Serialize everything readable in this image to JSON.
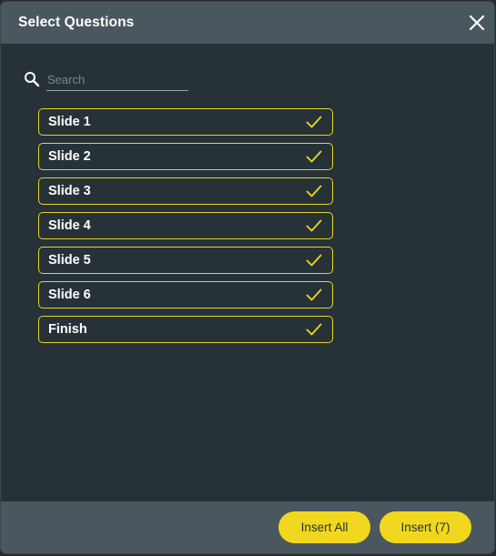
{
  "dialog": {
    "title": "Select Questions",
    "close_icon": "close-icon"
  },
  "search": {
    "placeholder": "Search",
    "value": "",
    "icon": "search-icon"
  },
  "questions": [
    {
      "label": "Slide 1",
      "checked": true
    },
    {
      "label": "Slide 2",
      "checked": true
    },
    {
      "label": "Slide 3",
      "checked": true
    },
    {
      "label": "Slide 4",
      "checked": true
    },
    {
      "label": "Slide 5",
      "checked": true
    },
    {
      "label": "Slide 6",
      "checked": true
    },
    {
      "label": "Finish",
      "checked": true
    }
  ],
  "footer": {
    "insert_all_label": "Insert All",
    "insert_label": "Insert (7)"
  },
  "colors": {
    "accent": "#f1d81e",
    "item_border": "#e8d32a",
    "dialog_bg": "#263238",
    "header_bg": "#4a575e"
  }
}
